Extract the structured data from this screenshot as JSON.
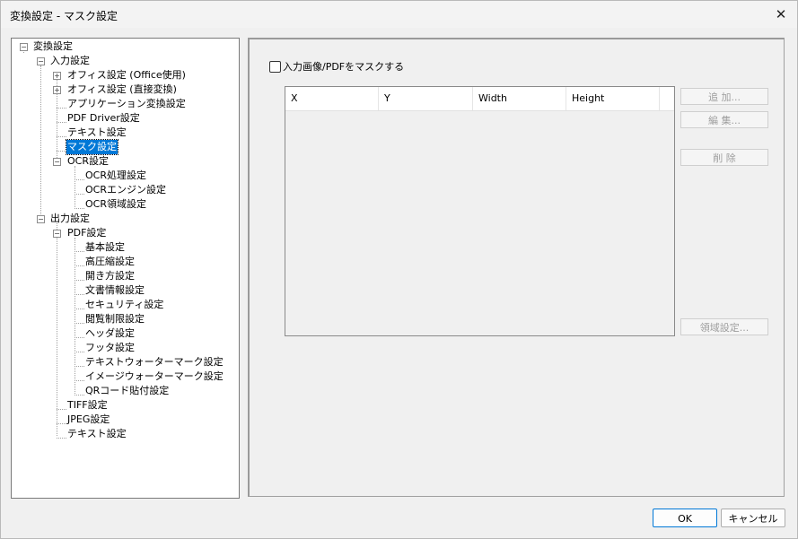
{
  "window": {
    "title": "変換設定 - マスク設定",
    "close_glyph": "✕"
  },
  "tree": {
    "expander_minus": "−",
    "expander_plus": "+",
    "root": "変換設定",
    "input": "入力設定",
    "office1": "オフィス設定 (Office使用)",
    "office2": "オフィス設定 (直接変換)",
    "app": "アプリケーション変換設定",
    "pdfdriver": "PDF Driver設定",
    "text_in": "テキスト設定",
    "mask": "マスク設定",
    "ocr": "OCR設定",
    "ocr_proc": "OCR処理設定",
    "ocr_engine": "OCRエンジン設定",
    "ocr_area": "OCR領域設定",
    "output": "出力設定",
    "pdf": "PDF設定",
    "basic": "基本設定",
    "compress": "高圧縮設定",
    "open": "開き方設定",
    "docinfo": "文書情報設定",
    "security": "セキュリティ設定",
    "viewlimit": "閲覧制限設定",
    "header": "ヘッダ設定",
    "footer": "フッタ設定",
    "textwm": "テキストウォーターマーク設定",
    "imagewm": "イメージウォーターマーク設定",
    "qr": "QRコード貼付設定",
    "tiff": "TIFF設定",
    "jpeg": "JPEG設定",
    "text_out": "テキスト設定"
  },
  "mask": {
    "checkbox_label": "入力画像/PDFをマスクする",
    "checked": false,
    "columns": [
      "X",
      "Y",
      "Width",
      "Height"
    ],
    "rows": [],
    "buttons": {
      "add": "追 加...",
      "edit": "編 集...",
      "delete": "削 除",
      "area": "領域設定..."
    }
  },
  "footer": {
    "ok": "OK",
    "cancel": "キャンセル"
  }
}
